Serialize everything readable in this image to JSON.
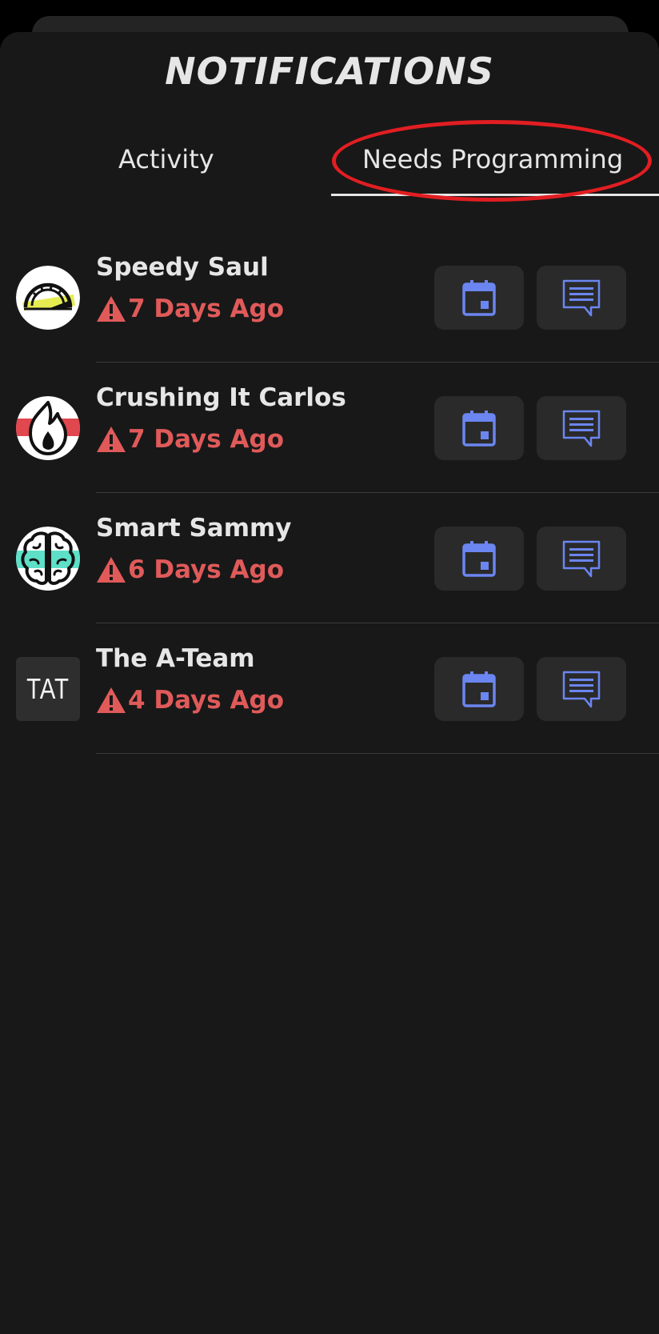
{
  "header": {
    "title": "NOTIFICATIONS"
  },
  "tabs": [
    {
      "label": "Activity",
      "active": false
    },
    {
      "label": "Needs Programming",
      "active": true,
      "highlighted": true
    }
  ],
  "colors": {
    "background": "#181818",
    "text": "#e6e6e6",
    "warning": "#e05a5a",
    "icon_accent": "#6b86f0",
    "highlight_ring": "#e11e22"
  },
  "notifications": [
    {
      "name": "Speedy Saul",
      "ago": "7 Days Ago",
      "avatar_icon": "speedometer-icon"
    },
    {
      "name": "Crushing It Carlos",
      "ago": "7 Days Ago",
      "avatar_icon": "flame-icon"
    },
    {
      "name": "Smart Sammy",
      "ago": "6 Days Ago",
      "avatar_icon": "brain-icon"
    },
    {
      "name": "The A-Team",
      "ago": "4 Days Ago",
      "avatar_text": "TAT"
    }
  ]
}
